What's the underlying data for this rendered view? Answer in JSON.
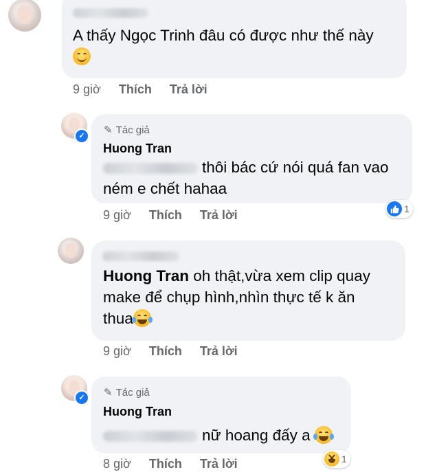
{
  "comments": [
    {
      "text": "A thấy Ngọc Trinh đâu có được như thế này",
      "time": "9 giờ",
      "like_label": "Thích",
      "reply_label": "Trả lời",
      "emoji": "smile-emoji"
    },
    {
      "author_tag": "Tác giả",
      "name": "Huong Tran",
      "text_line1": "thôi bác cứ nói quá fan vao",
      "text_line2": "ném e chết hahaa",
      "time": "9 giờ",
      "like_label": "Thích",
      "reply_label": "Trả lời",
      "reaction_icon": "like-icon",
      "reaction_count": "1"
    },
    {
      "mention": "Huong Tran",
      "text_line1": "oh thật,vừa xem  clip quay",
      "text_line2": "make để chụp hình,nhìn thực tế k ăn",
      "text_line3": "thua",
      "time": "9 giờ",
      "like_label": "Thích",
      "reply_label": "Trả lời",
      "emoji": "laughing-tears-emoji"
    },
    {
      "author_tag": "Tác giả",
      "name": "Huong Tran",
      "text": "nữ hoang đấy a",
      "time": "8 giờ",
      "like_label": "Thích",
      "reply_label": "Trả lời",
      "emoji": "laughing-tears-emoji",
      "reaction_icon": "haha-icon",
      "reaction_count": "1"
    }
  ],
  "colors": {
    "bubble": "#f0f2f5",
    "meta": "#65676b",
    "accent": "#1877f2"
  }
}
